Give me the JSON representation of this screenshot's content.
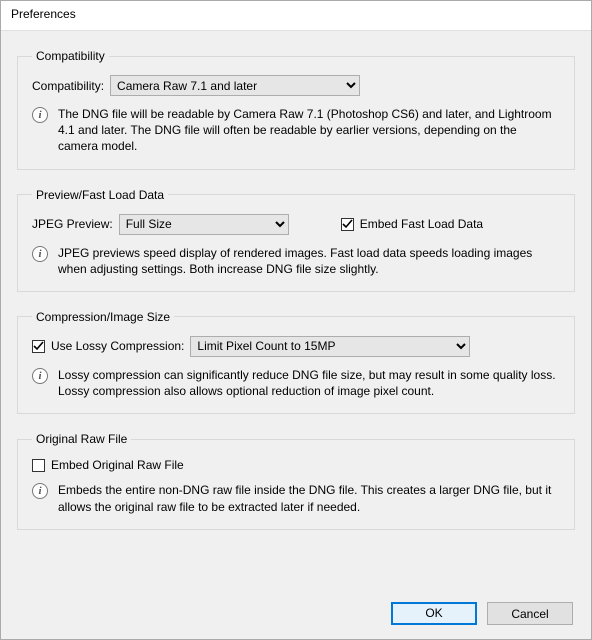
{
  "window": {
    "title": "Preferences"
  },
  "groups": {
    "compatibility": {
      "legend": "Compatibility",
      "label": "Compatibility:",
      "value": "Camera Raw 7.1 and later",
      "info": "The DNG file will be readable by Camera Raw 7.1 (Photoshop CS6) and later, and Lightroom 4.1 and later. The DNG file will often be readable by earlier versions, depending on the camera model."
    },
    "preview": {
      "legend": "Preview/Fast Load Data",
      "label": "JPEG Preview:",
      "value": "Full Size",
      "embed_fast_load": {
        "checked": true,
        "label": "Embed Fast Load Data"
      },
      "info": "JPEG previews speed display of rendered images.  Fast load data speeds loading images when adjusting settings.  Both increase DNG file size slightly."
    },
    "compression": {
      "legend": "Compression/Image Size",
      "use_lossy": {
        "checked": true,
        "label": "Use Lossy Compression:"
      },
      "value": "Limit Pixel Count to 15MP",
      "info": "Lossy compression can significantly reduce DNG file size, but may result in some quality loss.  Lossy compression also allows optional reduction of image pixel count."
    },
    "original": {
      "legend": "Original Raw File",
      "embed_original": {
        "checked": false,
        "label": "Embed Original Raw File"
      },
      "info": "Embeds the entire non-DNG raw file inside the DNG file.  This creates a larger DNG file, but it allows the original raw file to be extracted later if needed."
    }
  },
  "buttons": {
    "ok": "OK",
    "cancel": "Cancel"
  }
}
